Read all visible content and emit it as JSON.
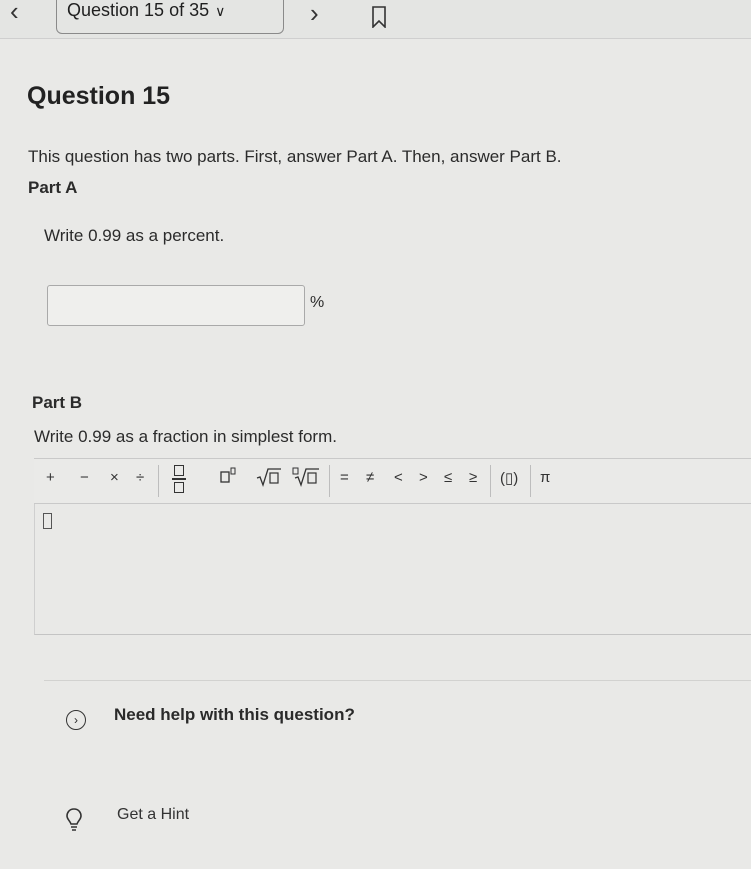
{
  "nav": {
    "question_selector": "Question 15 of 35"
  },
  "question": {
    "title": "Question 15",
    "intro": "This question has two parts. First, answer Part A. Then, answer Part B.",
    "part_a": {
      "heading": "Part A",
      "prompt": "Write 0.99 as a percent.",
      "input_value": "",
      "unit": "%"
    },
    "part_b": {
      "heading": "Part B",
      "prompt": "Write 0.99 as a fraction in simplest form.",
      "input_value": ""
    }
  },
  "toolbar": {
    "plus": "+",
    "minus": "−",
    "times": "×",
    "divide": "÷",
    "equals": "=",
    "not_equal": "≠",
    "less": "<",
    "greater": ">",
    "less_equal": "≤",
    "greater_equal": "≥",
    "paren": "(▯)",
    "pi": "π"
  },
  "help": {
    "label": "Need help with this question?",
    "hint_label": "Get a Hint"
  },
  "icons": {
    "back": "chevron-left-icon",
    "forward": "chevron-right-icon",
    "bookmark": "bookmark-icon",
    "hint": "lightbulb-icon",
    "expand": "chevron-right-circle-icon"
  }
}
